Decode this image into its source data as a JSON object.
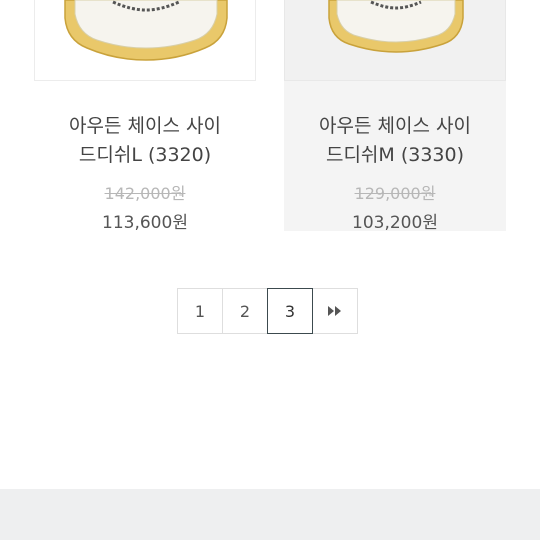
{
  "products": [
    {
      "name_line1": "아우든 체이스 사이",
      "name_line2": "드디쉬L (3320)",
      "original_price": "142,000원",
      "sale_price": "113,600원"
    },
    {
      "name_line1": "아우든 체이스 사이",
      "name_line2": "드디쉬M (3330)",
      "original_price": "129,000원",
      "sale_price": "103,200원"
    }
  ],
  "pagination": {
    "pages": [
      "1",
      "2",
      "3"
    ],
    "current": "3",
    "next_icon": "fast-forward-icon"
  },
  "colors": {
    "dish_rim": "#e9c86a",
    "dish_rim_dark": "#c9a23b",
    "active_border": "#3c4a4e",
    "footer_bg": "#eeeff0"
  }
}
